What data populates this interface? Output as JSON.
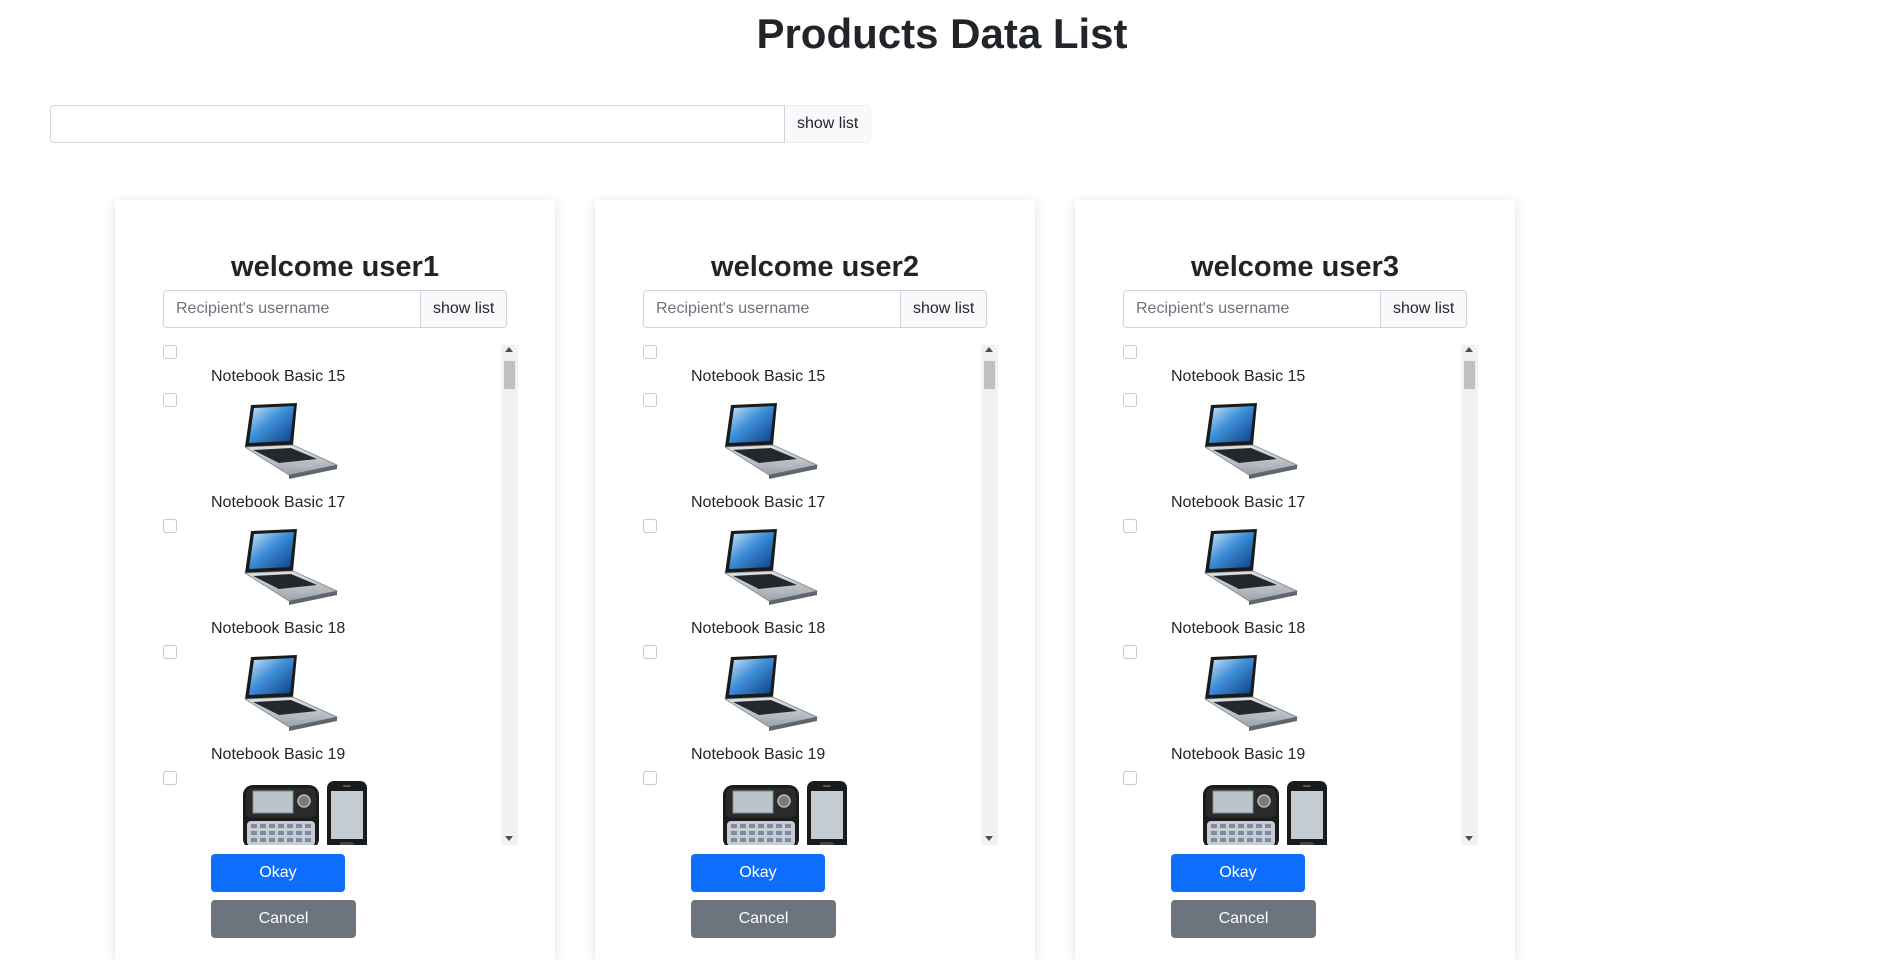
{
  "page": {
    "title": "Products Data List"
  },
  "top_search": {
    "value": "",
    "button_label": "show list"
  },
  "cards": [
    {
      "title": "welcome user1",
      "search": {
        "placeholder": "Recipient's username",
        "button_label": "show list"
      },
      "items": [
        {
          "label": "Notebook Basic 15",
          "image": "laptop-image"
        },
        {
          "label": "Notebook Basic 17",
          "image": "laptop-image"
        },
        {
          "label": "Notebook Basic 18",
          "image": "laptop-image"
        },
        {
          "label": "Notebook Basic 19",
          "image": "phone-image"
        }
      ],
      "okay_label": "Okay",
      "cancel_label": "Cancel"
    },
    {
      "title": "welcome user2",
      "search": {
        "placeholder": "Recipient's username",
        "button_label": "show list"
      },
      "items": [
        {
          "label": "Notebook Basic 15",
          "image": "laptop-image"
        },
        {
          "label": "Notebook Basic 17",
          "image": "laptop-image"
        },
        {
          "label": "Notebook Basic 18",
          "image": "laptop-image"
        },
        {
          "label": "Notebook Basic 19",
          "image": "phone-image"
        }
      ],
      "okay_label": "Okay",
      "cancel_label": "Cancel"
    },
    {
      "title": "welcome user3",
      "search": {
        "placeholder": "Recipient's username",
        "button_label": "show list"
      },
      "items": [
        {
          "label": "Notebook Basic 15",
          "image": "laptop-image"
        },
        {
          "label": "Notebook Basic 17",
          "image": "laptop-image"
        },
        {
          "label": "Notebook Basic 18",
          "image": "laptop-image"
        },
        {
          "label": "Notebook Basic 19",
          "image": "phone-image"
        }
      ],
      "okay_label": "Okay",
      "cancel_label": "Cancel"
    }
  ],
  "colors": {
    "primary": "#0d6efd",
    "secondary": "#6c757d",
    "scrollbar_track": "#f1f1f1"
  }
}
